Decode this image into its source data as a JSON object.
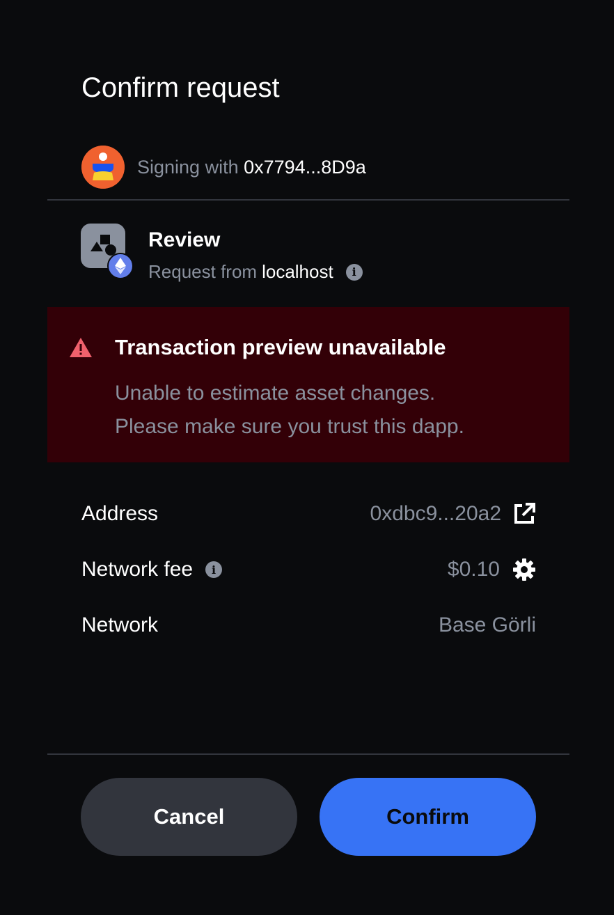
{
  "header": {
    "title": "Confirm request"
  },
  "signing": {
    "prefix": "Signing with",
    "address": "0x7794...8D9a"
  },
  "review": {
    "title": "Review",
    "request_prefix": "Request from",
    "host": "localhost"
  },
  "warning": {
    "title": "Transaction preview unavailable",
    "line1": "Unable to estimate asset changes.",
    "line2": "Please make sure you trust this dapp."
  },
  "details": {
    "address_label": "Address",
    "address_value": "0xdbc9...20a2",
    "fee_label": "Network fee",
    "fee_value": "$0.10",
    "network_label": "Network",
    "network_value": "Base Görli"
  },
  "actions": {
    "cancel_label": "Cancel",
    "confirm_label": "Confirm"
  },
  "colors": {
    "background": "#0a0b0d",
    "warning_bg": "#330007",
    "warning_icon": "#f0616d",
    "primary": "#3773f5",
    "secondary_button": "#32353d",
    "muted_text": "#8a919e"
  },
  "icons": {
    "avatar": "user-avatar-icon",
    "dapp": "dapp-shapes-icon",
    "chain": "ethereum-icon",
    "info": "info-icon",
    "warning": "warning-triangle-icon",
    "external": "external-link-icon",
    "settings": "gear-icon"
  }
}
